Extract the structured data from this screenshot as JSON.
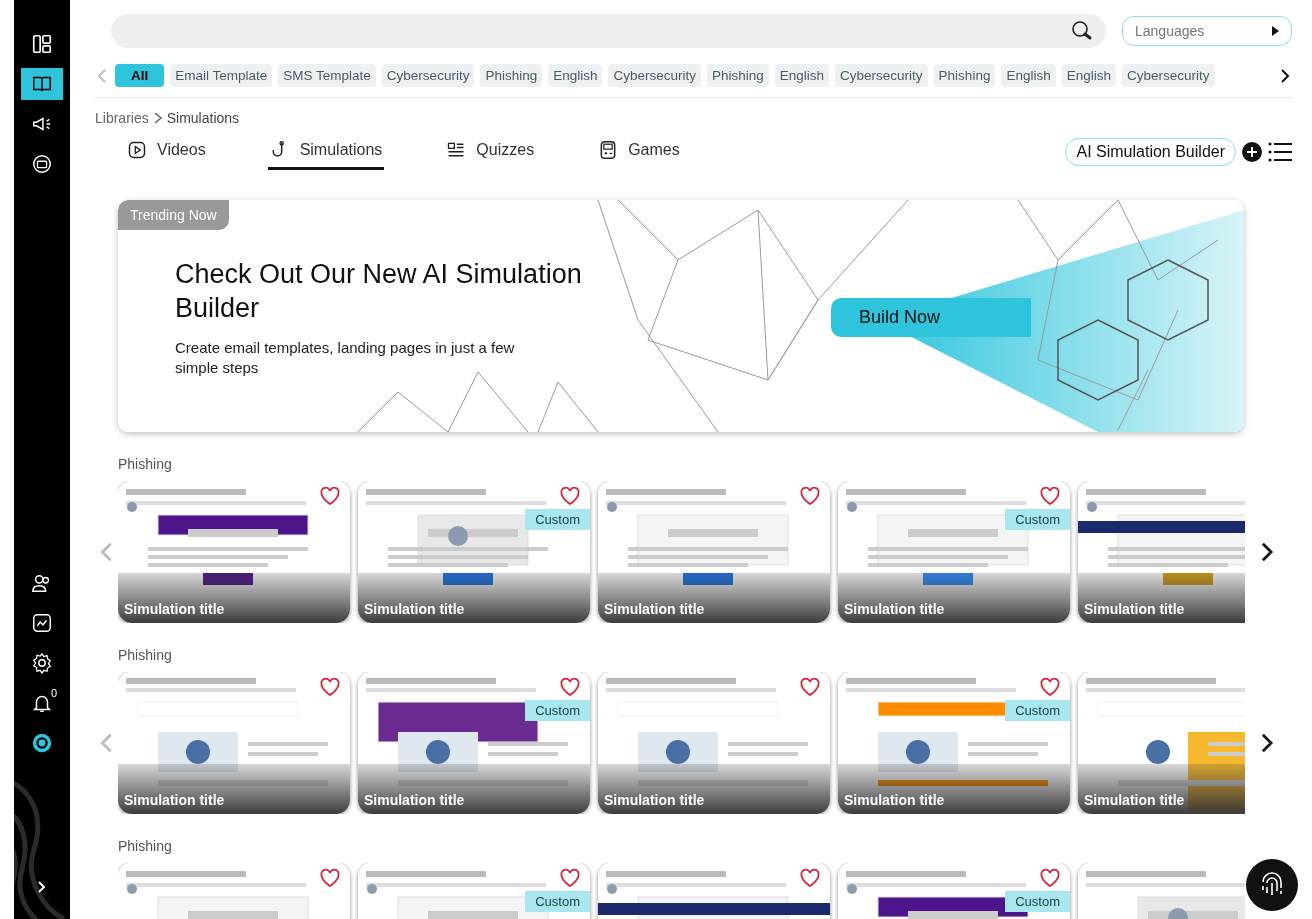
{
  "sidebar": {
    "top_items": [
      {
        "kind": "grid",
        "selected": false
      },
      {
        "kind": "book",
        "selected": true
      },
      {
        "kind": "megaphone",
        "selected": false
      },
      {
        "kind": "coins",
        "selected": false
      }
    ],
    "bottom_items": [
      {
        "kind": "people",
        "selected": false
      },
      {
        "kind": "chart",
        "selected": false
      },
      {
        "kind": "gear",
        "selected": false
      },
      {
        "kind": "bell",
        "selected": false,
        "badge": "0"
      },
      {
        "kind": "profile",
        "selected": false
      }
    ]
  },
  "languages": {
    "placeholder": "Languages"
  },
  "filter_chips": [
    {
      "label": "All",
      "selected": true
    },
    {
      "label": "Email Template",
      "selected": false
    },
    {
      "label": "SMS Template",
      "selected": false
    },
    {
      "label": "Cybersecurity",
      "selected": false
    },
    {
      "label": "Phishing",
      "selected": false
    },
    {
      "label": "English",
      "selected": false
    },
    {
      "label": "Cybersecurity",
      "selected": false
    },
    {
      "label": "Phishing",
      "selected": false
    },
    {
      "label": "English",
      "selected": false
    },
    {
      "label": "Cybersecurity",
      "selected": false
    },
    {
      "label": "Phishing",
      "selected": false
    },
    {
      "label": "English",
      "selected": false
    },
    {
      "label": "English",
      "selected": false
    },
    {
      "label": "Cybersecurity",
      "selected": false
    }
  ],
  "breadcrumb": [
    "Libraries",
    "Simulations"
  ],
  "tabs": [
    {
      "kind": "video",
      "label": "Videos",
      "selected": false
    },
    {
      "kind": "hook",
      "label": "Simulations",
      "selected": true
    },
    {
      "kind": "list",
      "label": "Quizzes",
      "selected": false
    },
    {
      "kind": "game",
      "label": "Games",
      "selected": false
    }
  ],
  "builder_button": "AI Simulation Builder",
  "banner": {
    "tag": "Trending Now",
    "title": "Check Out Our New AI Simulation Builder",
    "subtitle": "Create email templates, landing pages in just a few simple steps",
    "button": "Build Now"
  },
  "sections": [
    {
      "title": "Phishing",
      "arrows": true,
      "cards": [
        {
          "kind": "picture",
          "title": "Simulation title",
          "heart": true
        },
        {
          "kind": "picture",
          "title": "Simulation title",
          "badge": "Custom",
          "heart": true
        },
        {
          "kind": "picture",
          "title": "Simulation title",
          "heart": true
        },
        {
          "kind": "picture",
          "title": "Simulation title",
          "badge": "Custom",
          "heart": true
        },
        {
          "kind": "picture",
          "title": "Simulation title",
          "heart": false
        }
      ]
    },
    {
      "title": "Phishing",
      "arrows": true,
      "cards": [
        {
          "kind": "picture",
          "title": "Simulation title",
          "heart": true
        },
        {
          "kind": "picture",
          "title": "Simulation title",
          "badge": "Custom",
          "heart": true
        },
        {
          "kind": "picture",
          "title": "Simulation title",
          "heart": true
        },
        {
          "kind": "picture",
          "title": "Simulation title",
          "badge": "Custom",
          "heart": true
        },
        {
          "kind": "picture",
          "title": "Simulation title",
          "heart": false
        }
      ]
    },
    {
      "title": "Phishing",
      "arrows": false,
      "cards": [
        {
          "kind": "picture",
          "heart": true
        },
        {
          "kind": "picture",
          "badge": "Custom",
          "heart": true
        },
        {
          "kind": "picture",
          "heart": true
        },
        {
          "kind": "picture",
          "badge": "Custom",
          "heart": true
        },
        {
          "kind": "picture",
          "heart": false
        }
      ]
    }
  ]
}
